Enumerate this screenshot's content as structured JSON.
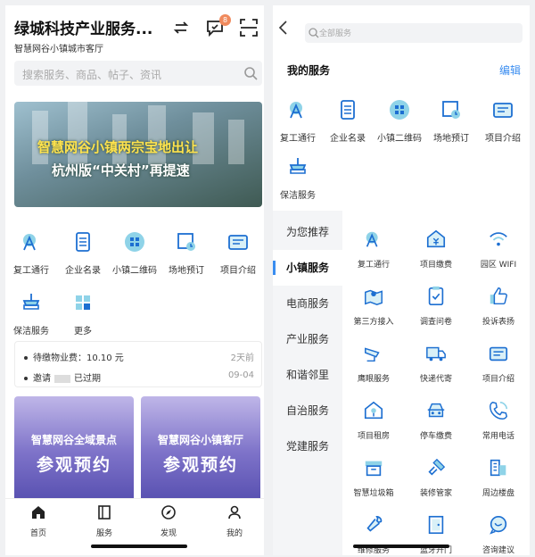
{
  "left": {
    "header": {
      "title": "绿城科技产业服务...",
      "subtitle": "智慧网谷小镇城市客厅",
      "badge_count": "8"
    },
    "search": {
      "placeholder": "搜索服务、商品、帖子、资讯"
    },
    "banner": {
      "line1": "智慧网谷小镇两宗宝地出让",
      "line2": "杭州版“中关村”再提速"
    },
    "grid": [
      {
        "label": "复工通行",
        "icon": "person-pass-icon"
      },
      {
        "label": "企业名录",
        "icon": "directory-icon"
      },
      {
        "label": "小镇二维码",
        "icon": "qr-grid-icon"
      },
      {
        "label": "场地预订",
        "icon": "venue-booking-icon"
      },
      {
        "label": "项目介绍",
        "icon": "project-intro-icon"
      },
      {
        "label": "保洁服务",
        "icon": "cleaning-icon"
      },
      {
        "label": "更多",
        "icon": "more-icon"
      }
    ],
    "notices": [
      {
        "text": "待缴物业费：10.10 元",
        "time": "2天前"
      },
      {
        "prefix": "邀请",
        "suffix": "已过期",
        "time": "09-04"
      }
    ],
    "cards": [
      {
        "line1": "智慧网谷全域景点",
        "line2": "参观预约"
      },
      {
        "line1": "智慧网谷小镇客厅",
        "line2": "参观预约"
      }
    ],
    "tabs": [
      {
        "label": "首页",
        "icon": "home-icon"
      },
      {
        "label": "服务",
        "icon": "service-book-icon"
      },
      {
        "label": "发现",
        "icon": "compass-icon"
      },
      {
        "label": "我的",
        "icon": "user-icon"
      }
    ]
  },
  "right": {
    "search": {
      "placeholder": "全部服务"
    },
    "my_services": {
      "title": "我的服务",
      "edit": "编辑",
      "items": [
        {
          "label": "复工通行",
          "icon": "person-pass-icon"
        },
        {
          "label": "企业名录",
          "icon": "directory-icon"
        },
        {
          "label": "小镇二维码",
          "icon": "qr-grid-icon"
        },
        {
          "label": "场地预订",
          "icon": "venue-booking-icon"
        },
        {
          "label": "项目介绍",
          "icon": "project-intro-icon"
        },
        {
          "label": "保洁服务",
          "icon": "cleaning-icon"
        }
      ]
    },
    "categories": [
      "为您推荐",
      "小镇服务",
      "电商服务",
      "产业服务",
      "和谐邻里",
      "自治服务",
      "党建服务"
    ],
    "active_category": "小镇服务",
    "services": [
      {
        "label": "复工通行",
        "icon": "person-pass-icon"
      },
      {
        "label": "项目缴费",
        "icon": "payment-icon"
      },
      {
        "label": "园区 WIFI",
        "icon": "wifi-icon"
      },
      {
        "label": "第三方接入",
        "icon": "map-pin-icon"
      },
      {
        "label": "调查问卷",
        "icon": "survey-icon"
      },
      {
        "label": "投诉表扬",
        "icon": "thumbs-up-icon"
      },
      {
        "label": "鹰眼服务",
        "icon": "cctv-icon"
      },
      {
        "label": "快递代寄",
        "icon": "truck-icon"
      },
      {
        "label": "项目介绍",
        "icon": "project-intro-icon"
      },
      {
        "label": "项目租房",
        "icon": "house-key-icon"
      },
      {
        "label": "停车缴费",
        "icon": "car-icon"
      },
      {
        "label": "常用电话",
        "icon": "phone-icon"
      },
      {
        "label": "智慧垃圾箱",
        "icon": "trash-box-icon"
      },
      {
        "label": "装修管家",
        "icon": "paint-roller-icon"
      },
      {
        "label": "周边楼盘",
        "icon": "building-icon"
      },
      {
        "label": "维修服务",
        "icon": "wrench-icon"
      },
      {
        "label": "蓝牙开门",
        "icon": "door-icon"
      },
      {
        "label": "咨询建议",
        "icon": "chat-bubble-icon"
      }
    ]
  },
  "colors": {
    "icon_blue": "#1d6fd1",
    "icon_light": "#8fd3e8",
    "accent": "#3a8df0",
    "badge": "#f08a5d"
  }
}
